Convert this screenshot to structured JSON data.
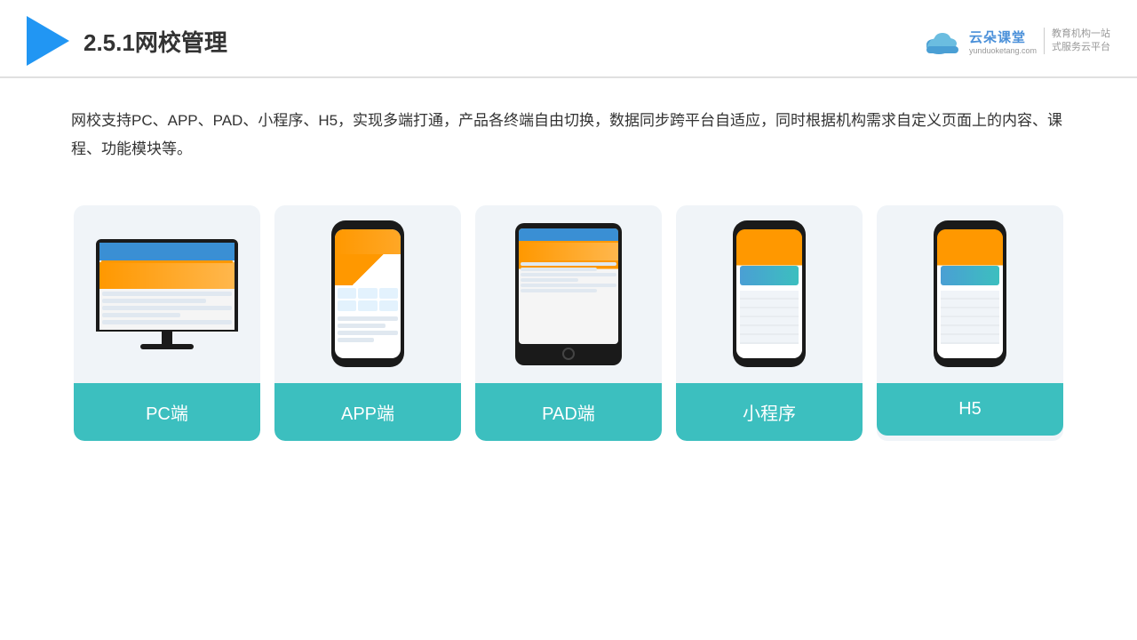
{
  "header": {
    "title": "2.5.1网校管理",
    "logo_name": "云朵课堂",
    "logo_url": "yunduoketang.com",
    "logo_tagline": "教育机构一站\n式服务云平台"
  },
  "description": {
    "text": "网校支持PC、APP、PAD、小程序、H5，实现多端打通，产品各终端自由切换，数据同步跨平台自适应，同时根据机构需求自定义页面上的内容、课程、功能模块等。"
  },
  "cards": [
    {
      "id": "pc",
      "label": "PC端"
    },
    {
      "id": "app",
      "label": "APP端"
    },
    {
      "id": "pad",
      "label": "PAD端"
    },
    {
      "id": "miniapp",
      "label": "小程序"
    },
    {
      "id": "h5",
      "label": "H5"
    }
  ]
}
